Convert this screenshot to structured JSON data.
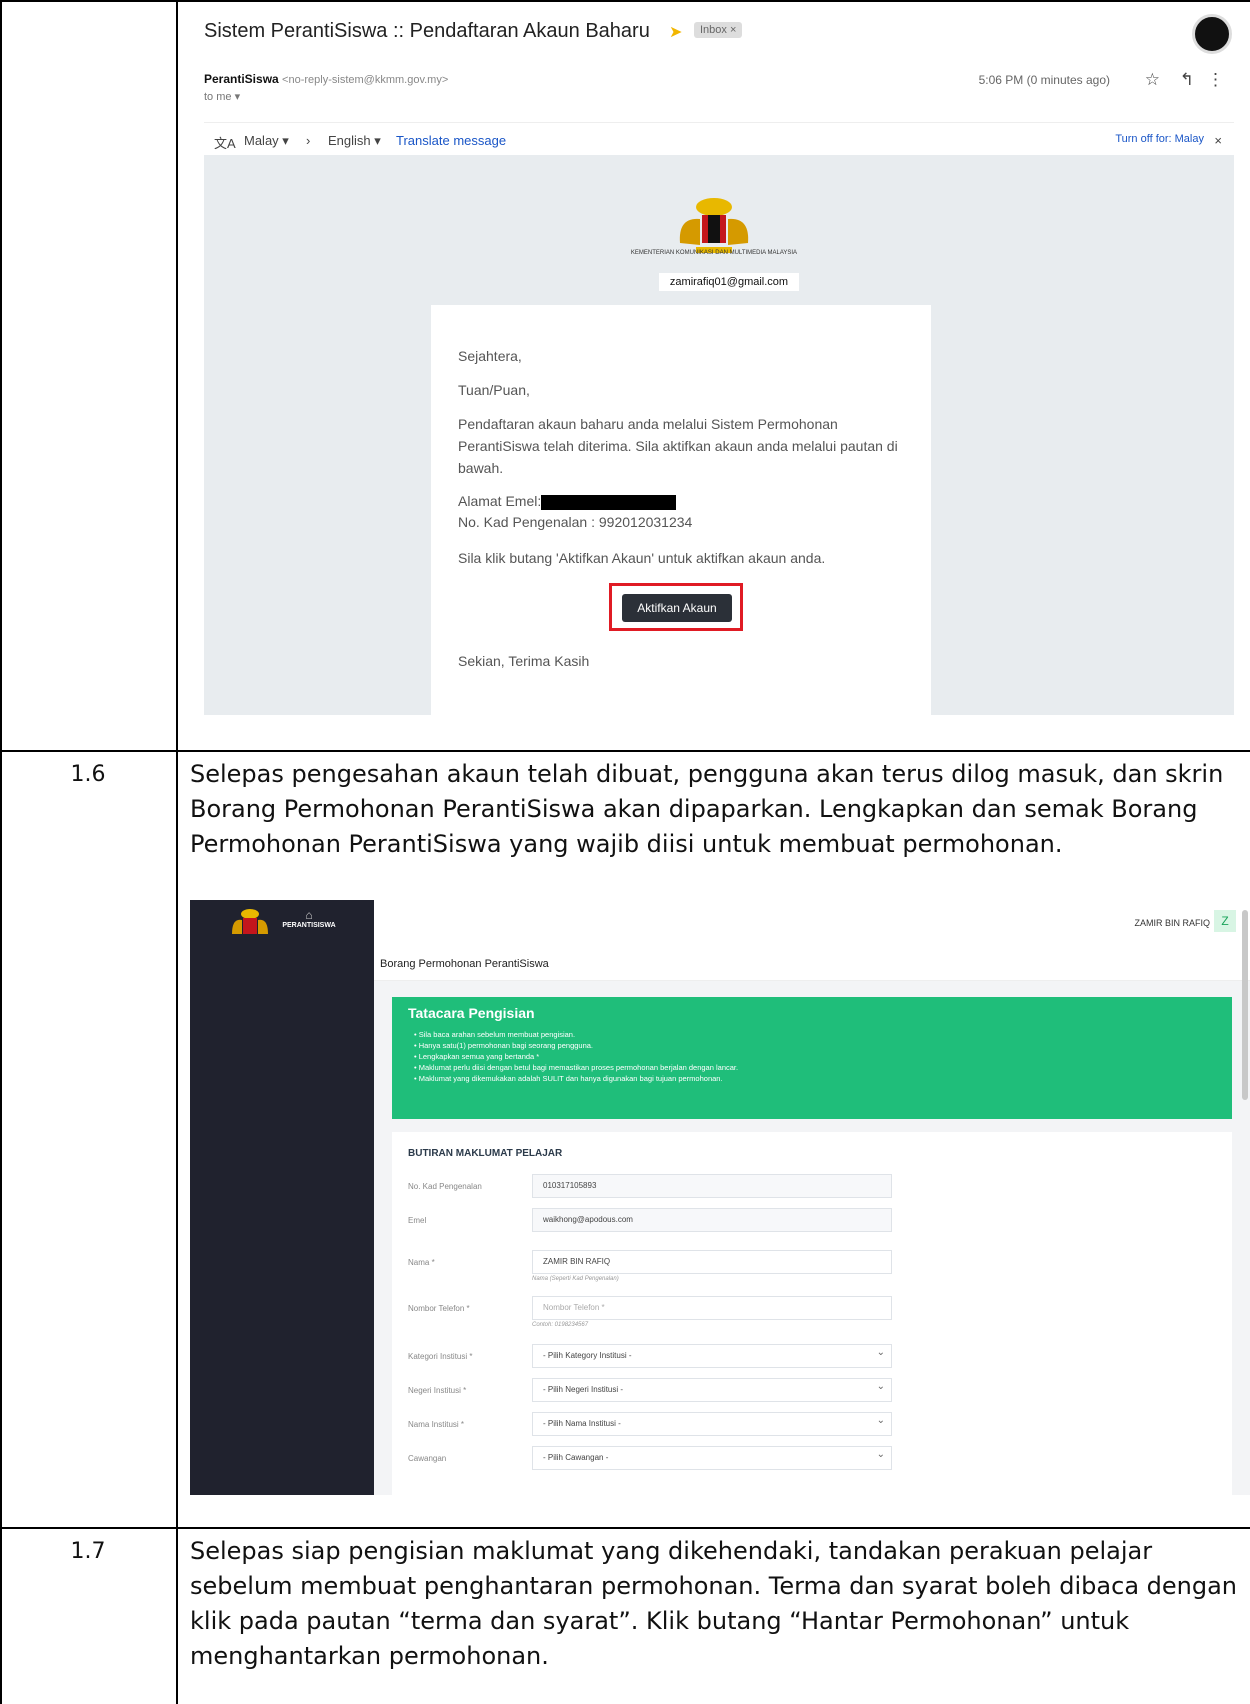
{
  "gmail": {
    "subject": "Sistem PerantiSiswa :: Pendaftaran Akaun Baharu",
    "inbox_badge": "Inbox ×",
    "sender_name": "PerantiSiswa",
    "sender_email": "<no-reply-sistem@kkmm.gov.my>",
    "to_me": "to me ▾",
    "time": "5:06 PM (0 minutes ago)",
    "lang_from": "Malay ▾",
    "lang_arrow": "›",
    "lang_to": "English ▾",
    "translate_link": "Translate message",
    "turn_off": "Turn off for: Malay",
    "ministry": "KEMENTERIAN KOMUNIKASI DAN MULTIMEDIA MALAYSIA",
    "email_chip": "zamirafiq01@gmail.com",
    "greeting": "Sejahtera,",
    "salutation": "Tuan/Puan,",
    "body": "Pendaftaran akaun baharu anda melalui Sistem Permohonan PerantiSiswa telah diterima. Sila aktifkan akaun anda melalui pautan di bawah.",
    "email_label": "Alamat Emel:",
    "ic_line": "No. Kad Pengenalan : 992012031234",
    "instruction": "Sila klik butang 'Aktifkan Akaun' untuk aktifkan akaun anda.",
    "button": "Aktifkan Akaun",
    "closing": "Sekian, Terima Kasih"
  },
  "steps": [
    {
      "num": "1.6",
      "text": "Selepas pengesahan akaun telah dibuat, pengguna akan terus dilog masuk, dan skrin Borang Permohonan PerantiSiswa akan dipaparkan. Lengkapkan dan semak Borang Permohonan PerantiSiswa yang wajib diisi untuk membuat permohonan."
    },
    {
      "num": "1.7",
      "text": "Selepas siap pengisian maklumat yang dikehendaki, tandakan perakuan pelajar sebelum membuat penghantaran permohonan. Terma dan syarat boleh dibaca dengan klik pada pautan “terma dan syarat”. Klik butang “Hantar Permohonan” untuk menghantarkan permohonan."
    }
  ],
  "app": {
    "logo_text": "PERANTISISWA",
    "user_name": "ZAMIR BIN RAFIQ",
    "avatar": "Z",
    "page_title": "Borang Permohonan PerantiSiswa",
    "guide_title": "Tatacara Pengisian",
    "guide_items": [
      "Sila baca arahan sebelum membuat pengisian.",
      "Hanya satu(1) permohonan bagi seorang pengguna.",
      "Lengkapkan semua yang bertanda *",
      "Maklumat perlu diisi dengan betul bagi memastikan proses permohonan berjalan dengan lancar.",
      "Maklumat yang dikemukakan adalah SULIT dan hanya digunakan bagi tujuan permohonan."
    ],
    "section_title": "BUTIRAN MAKLUMAT PELAJAR",
    "fields": [
      {
        "label": "No. Kad Pengenalan",
        "value": "010317105893",
        "help": ""
      },
      {
        "label": "Emel",
        "value": "waikhong@apodous.com",
        "help": ""
      },
      {
        "label": "Nama *",
        "value": "ZAMIR BIN RAFIQ",
        "help": "Nama (Seperti Kad Pengenalan)"
      },
      {
        "label": "Nombor Telefon *",
        "value": "Nombor Telefon *",
        "help": "Contoh: 0198234567"
      },
      {
        "label": "Kategori Institusi *",
        "value": "- Pilih Kategory Institusi -",
        "help": ""
      },
      {
        "label": "Negeri Institusi *",
        "value": "- Pilih Negeri Institusi -",
        "help": ""
      },
      {
        "label": "Nama Institusi *",
        "value": "- Pilih Nama Institusi -",
        "help": ""
      },
      {
        "label": "Cawangan",
        "value": "- Pilih Cawangan -",
        "help": ""
      }
    ]
  }
}
